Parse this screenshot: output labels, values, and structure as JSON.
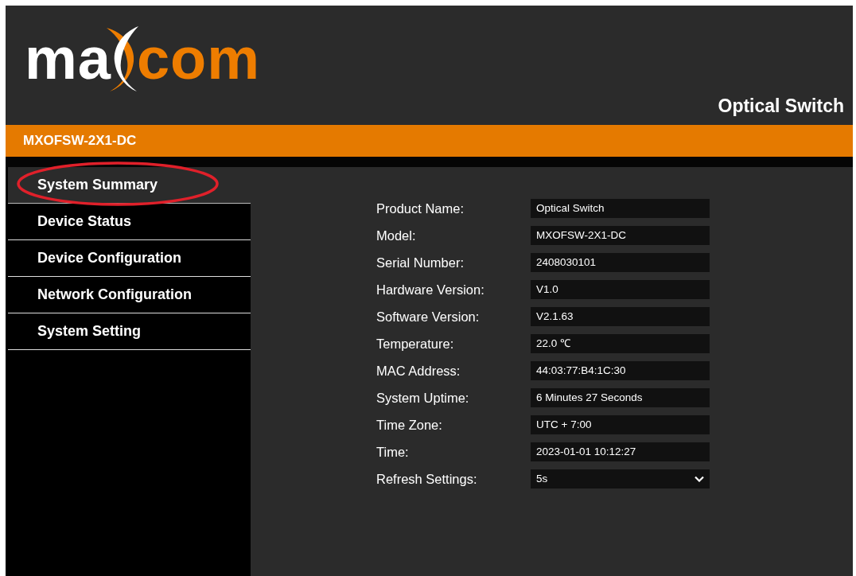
{
  "header": {
    "logo": {
      "left": "ma",
      "right": "com"
    },
    "title": "Optical Switch"
  },
  "device_bar": {
    "model": "MXOFSW-2X1-DC"
  },
  "sidebar": {
    "items": [
      {
        "label": "System Summary",
        "selected": true,
        "circled": true
      },
      {
        "label": "Device Status",
        "selected": false,
        "circled": false
      },
      {
        "label": "Device Configuration",
        "selected": false,
        "circled": false
      },
      {
        "label": "Network Configuration",
        "selected": false,
        "circled": false
      },
      {
        "label": "System Setting",
        "selected": false,
        "circled": false
      }
    ]
  },
  "summary": {
    "fields": [
      {
        "label": "Product Name:",
        "value": "Optical Switch",
        "kind": "text"
      },
      {
        "label": "Model:",
        "value": "MXOFSW-2X1-DC",
        "kind": "text"
      },
      {
        "label": "Serial Number:",
        "value": "2408030101",
        "kind": "text"
      },
      {
        "label": "Hardware Version:",
        "value": "V1.0",
        "kind": "text"
      },
      {
        "label": "Software Version:",
        "value": "V2.1.63",
        "kind": "text"
      },
      {
        "label": "Temperature:",
        "value": "22.0 ℃",
        "kind": "text"
      },
      {
        "label": "MAC Address:",
        "value": "44:03:77:B4:1C:30",
        "kind": "text"
      },
      {
        "label": "System Uptime:",
        "value": "6 Minutes 27 Seconds",
        "kind": "text"
      },
      {
        "label": "Time Zone:",
        "value": "UTC + 7:00",
        "kind": "text"
      },
      {
        "label": "Time:",
        "value": "2023-01-01 10:12:27",
        "kind": "text"
      },
      {
        "label": "Refresh Settings:",
        "value": "5s",
        "kind": "select"
      }
    ]
  }
}
